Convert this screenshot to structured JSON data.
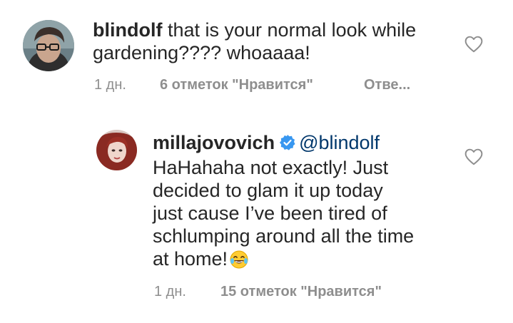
{
  "comments": [
    {
      "username": "blindolf",
      "text_line1": "that is your normal look while",
      "text_line2": "gardening???? whoaaaa!",
      "time": "1 дн.",
      "likes": "6 отметок \"Нравится\"",
      "reply": "Отве...",
      "heart_icon": "heart-outline-icon"
    },
    {
      "username": "millajovovich",
      "verified_icon": "verified-badge-icon",
      "mention": "@blindolf",
      "lines": [
        "HaHahaha not exactly! Just",
        "decided to glam it up today",
        "just cause I’ve been tired of",
        "schlumping around all the time",
        "at home!"
      ],
      "emoji": "laughing-tears-emoji",
      "time": "1 дн.",
      "likes": "15 отметок \"Нравится\"",
      "heart_icon": "heart-outline-icon"
    }
  ],
  "colors": {
    "text": "#262626",
    "meta": "#8e8e8e",
    "mention": "#00376b",
    "verified": "#3897f0"
  }
}
